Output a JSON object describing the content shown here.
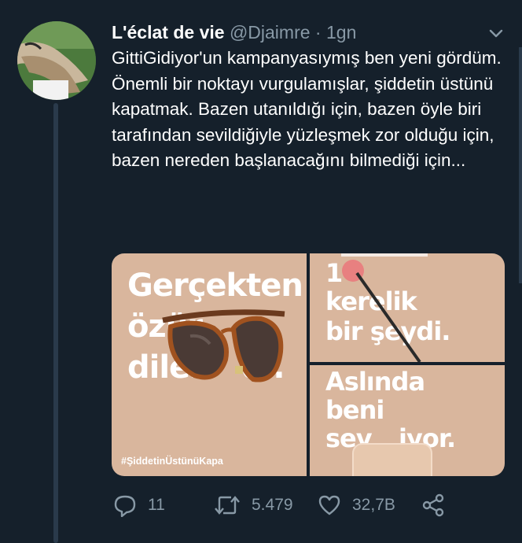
{
  "tweet": {
    "display_name": "L'éclat de vie",
    "handle": "@Djaimre",
    "separator": "·",
    "time": "1gn",
    "text": "GittiGidiyor'un kampanyasıymış ben yeni gördüm. Önemli bir noktayı vurgulamışlar, şiddetin üstünü kapatmak. Bazen utanıldığı için, bazen öyle biri tarafından sevildiğiyle yüzleşmek zor olduğu için, bazen nereden başlanacağını bilmediği için..."
  },
  "media": {
    "panel1": {
      "line1": "Gerçekten",
      "line2": "özür",
      "line3a": "diler",
      "line3b": "di.",
      "hashtag": "#ŞiddetinÜstünüKapa"
    },
    "panel2": {
      "line1": "1",
      "line2": "kerelik",
      "line3": "bir şeydi."
    },
    "panel3": {
      "line1": "Aslında",
      "line2": "beni",
      "line3a": "sev",
      "line3b": "iyor."
    }
  },
  "actions": {
    "replies": "11",
    "retweets": "5.479",
    "likes": "32,7B"
  },
  "colors": {
    "background": "#15202b",
    "secondary_text": "#8899a6",
    "panel_beige": "#d9b69d"
  },
  "icons": [
    "caret-down-icon",
    "reply-icon",
    "retweet-icon",
    "like-icon",
    "share-icon"
  ]
}
